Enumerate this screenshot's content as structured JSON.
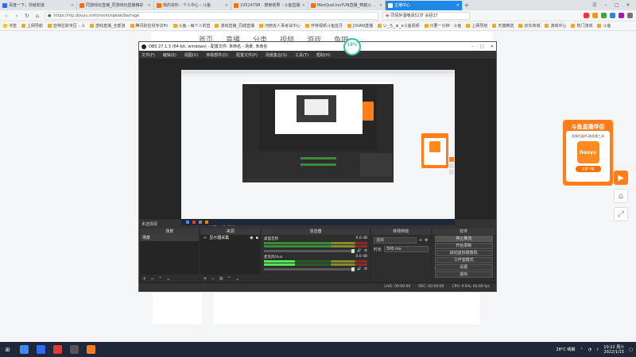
{
  "browser": {
    "tabs": [
      {
        "label": "百度一下，你就知道",
        "color": "#2f6bff",
        "active": false
      },
      {
        "label": "同游戏玩直播_同游戏玩直播精彩",
        "color": "#ff6f00",
        "active": false
      },
      {
        "label": "我的资料 - 个人中心 - 斗鱼",
        "color": "#ff6f00",
        "active": false
      },
      {
        "label": "10524798 - 搜索结果 - 斗鱼直播",
        "color": "#ff6f00",
        "active": false
      },
      {
        "label": "MesQueUnoYUN直播_穿越火线直",
        "color": "#ff6f00",
        "active": false
      },
      {
        "label": "主播中心",
        "color": "#ffffff",
        "active": true
      }
    ],
    "newtab_label": "+",
    "url": "https://mp.douyu.com/room/speak/barrage",
    "search_text": "同情醉酒嘲讽52岁 会招37",
    "bookmarks": [
      "书签",
      "上网导航",
      "亚特拉斯专区 - 斗",
      "游戏直播_全部游",
      "腾讯的在线专访Fir",
      "斗鱼 - 每个人的直",
      "游戏直播_同城直播",
      "河南省人事考试中心",
      "怀特视频斗鱼蓝牙",
      "JIXIAN直播",
      "い_ろ_ぁ_e斗鱼视频",
      "只要一分钟 · 斗鱼",
      "上网导航",
      "天猫精选",
      "京东商城",
      "游戏中心",
      "热门游戏",
      "斗鱼"
    ]
  },
  "douyu": {
    "nav": [
      "首页",
      "直播",
      "分类",
      "视频",
      "游戏",
      "鱼吧"
    ],
    "badge_value": "18",
    "badge_unit": "%",
    "promo_title": "斗鱼直播伴侣",
    "promo_subtitle": "直播利器PC端直播工具",
    "promo_icon_text": "Douyu",
    "promo_button": "立即下载"
  },
  "obs": {
    "title": "OBS 27.1.3 (64-bit, windows) - 配置文件: 未命名 - 场景: 未命名",
    "menu": [
      "文件(F)",
      "编辑(E)",
      "视图(V)",
      "停靠部件(D)",
      "配置文件(P)",
      "场景集合(S)",
      "工具(T)",
      "帮助(H)"
    ],
    "toolbar": {
      "no_source": "未选择源",
      "properties": "属性",
      "filters": "滤镜"
    },
    "docks": {
      "scenes": "场景",
      "sources": "来源",
      "mixer": "混音器",
      "transitions": "转场特效",
      "controls": "控件"
    },
    "scene_items": [
      "场景"
    ],
    "source_items": [
      "显示器采集"
    ],
    "mixer_channels": [
      {
        "name": "桌面音频",
        "db": "0.0 dB"
      },
      {
        "name": "麦克风/Aux",
        "db": "0.0 dB"
      }
    ],
    "transition": {
      "type": "淡出",
      "duration_label": "时长",
      "duration_value": "300 ms"
    },
    "controls": [
      "停止推流",
      "开始录制",
      "启动虚拟摄像机",
      "工作室模式",
      "设置",
      "退出"
    ],
    "status": {
      "live": "LIVE: 00:00:00",
      "rec": "REC: 00:00:00",
      "cpu": "CPU: 0.6%, 60.00 fps"
    }
  },
  "taskbar": {
    "weather": "28°C 晴朗",
    "time": "10:22 周六",
    "date": "2022/1/15"
  },
  "colors": {
    "accent": "#1e88e5",
    "douyu_orange": "#ff7d1a",
    "obs_dark": "#2b2b2b"
  }
}
